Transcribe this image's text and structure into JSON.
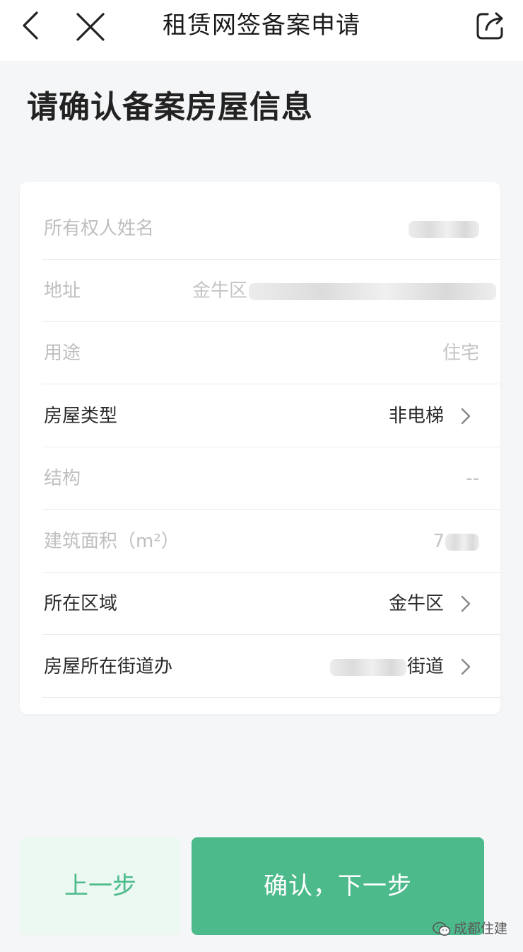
{
  "nav": {
    "title": "租赁网签备案申请"
  },
  "page": {
    "title": "请确认备案房屋信息"
  },
  "form": {
    "owner_name": {
      "label": "所有权人姓名",
      "value": ""
    },
    "address": {
      "label": "地址",
      "value": "金牛区"
    },
    "usage": {
      "label": "用途",
      "value": "住宅"
    },
    "house_type": {
      "label": "房屋类型",
      "value": "非电梯"
    },
    "structure": {
      "label": "结构",
      "value": "--"
    },
    "floor_area": {
      "label": "建筑面积（m²）",
      "value": "7"
    },
    "district": {
      "label": "所在区域",
      "value": "金牛区"
    },
    "street_office": {
      "label": "房屋所在街道办",
      "value": "街道"
    }
  },
  "buttons": {
    "prev": "上一步",
    "next": "确认，下一步"
  },
  "watermark": {
    "text": "成都住建"
  },
  "colors": {
    "accent": "#4cba8a",
    "accent_light": "#ecf8f2"
  }
}
